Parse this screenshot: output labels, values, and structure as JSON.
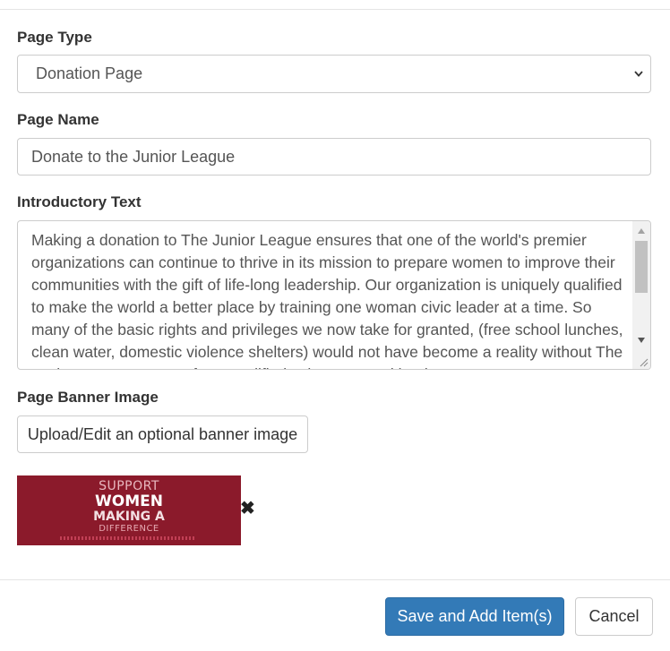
{
  "form": {
    "page_type": {
      "label": "Page Type",
      "selected": "Donation Page"
    },
    "page_name": {
      "label": "Page Name",
      "value": "Donate to the Junior League"
    },
    "intro_text": {
      "label": "Introductory Text",
      "value": "Making a donation to The Junior League ensures that one of the world's premier organizations can continue to thrive in its mission to prepare women to improve their communities with the gift of life-long leadership. Our organization is uniquely qualified to make the world a better place by training one woman civic leader at a time. So many of the basic rights and privileges we now take for granted, (free school lunches, clean water, domestic violence shelters) would not have become a reality without The Junior League or one of our qualified volunteers and leaders."
    },
    "banner": {
      "label": "Page Banner Image",
      "upload_label": "Upload/Edit an optional banner image",
      "thumbnail_lines": [
        "SUPPORT",
        "WOMEN",
        "MAKING A",
        "DIFFERENCE"
      ],
      "remove_glyph": "✖"
    }
  },
  "footer": {
    "save_label": "Save and Add Item(s)",
    "cancel_label": "Cancel"
  },
  "colors": {
    "primary": "#337ab7",
    "banner_bg": "#8b1a2b"
  },
  "icons": {
    "select_chevron": "chevron-down-icon",
    "remove": "close-icon"
  }
}
